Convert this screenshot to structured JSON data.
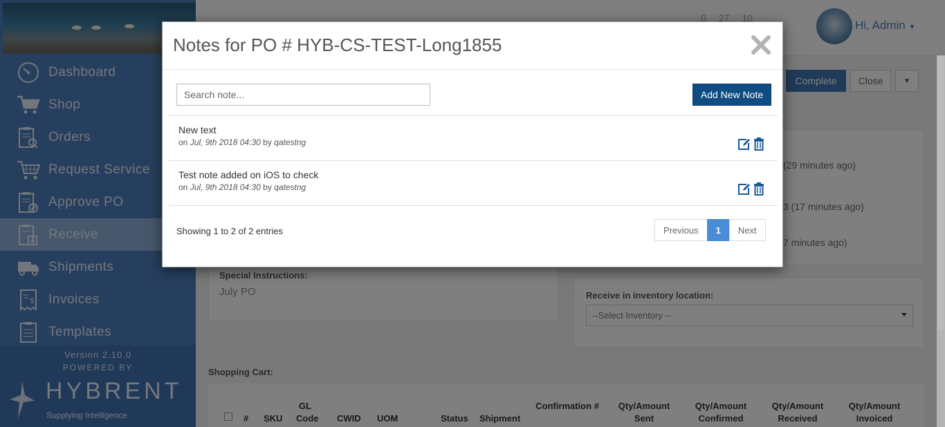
{
  "sidebar": {
    "items": [
      {
        "label": "Dashboard",
        "icon": "dashboard-gauge-icon"
      },
      {
        "label": "Shop",
        "icon": "shopping-cart-icon"
      },
      {
        "label": "Orders",
        "icon": "orders-clipboard-icon"
      },
      {
        "label": "Request Service",
        "icon": "request-service-cart-icon"
      },
      {
        "label": "Approve PO",
        "icon": "approve-po-clipboard-icon"
      },
      {
        "label": "Receive",
        "icon": "receive-clipboard-icon",
        "active": true
      },
      {
        "label": "Shipments",
        "icon": "truck-icon"
      },
      {
        "label": "Invoices",
        "icon": "invoice-icon"
      },
      {
        "label": "Templates",
        "icon": "templates-clipboard-icon"
      }
    ],
    "version": "Version 2.10.0",
    "powered_by": "POWERED BY",
    "logo_word": "HYBRENT",
    "logo_tagline": "Supplying Intelligence"
  },
  "topbar": {
    "counters": [
      "0",
      "27",
      "10"
    ],
    "user_greeting": "Hi, Admin"
  },
  "page": {
    "complete_label": "Complete",
    "close_label": "Close",
    "history": [
      "(29 minutes ago)",
      "3 (17 minutes ago)",
      "7 minutes ago)"
    ],
    "special_instructions_label": "Special Instructions:",
    "special_instructions_value": "July PO",
    "receive_location_label": "Receive in inventory location:",
    "inventory_select": "--Select Inventory --",
    "cart_title": "Shopping Cart:",
    "cart_headers": {
      "num": "#",
      "sku": "SKU",
      "gl_code": "GL Code",
      "cwid": "CWID",
      "uom": "UOM",
      "status": "Status",
      "shipment": "Shipment",
      "confirmation": "Confirmation #",
      "qty_sent": "Qty/Amount Sent",
      "qty_confirmed": "Qty/Amount Confirmed",
      "qty_received": "Qty/Amount Received",
      "qty_invoiced": "Qty/Amount Invoiced"
    }
  },
  "modal": {
    "title": "Notes for PO # HYB-CS-TEST-Long1855",
    "search_placeholder": "Search note...",
    "add_button": "Add New Note",
    "notes": [
      {
        "text": "New text",
        "prefix": "on",
        "date": "Jul, 9th 2018 04:30",
        "by": "by",
        "author": "qatestng"
      },
      {
        "text": "Test note added on iOS to check",
        "prefix": "on",
        "date": "Jul, 9th 2018 04:30",
        "by": "by",
        "author": "qatestng"
      }
    ],
    "entries_info": "Showing 1 to 2 of 2 entries",
    "pagination": {
      "previous": "Previous",
      "current": "1",
      "next": "Next"
    }
  },
  "colors": {
    "sidebar_bg": "#4f7fbd",
    "primary_button": "#0f4c81",
    "pagination_active": "#4a8dd6",
    "icon_blue": "#1a5a96"
  }
}
